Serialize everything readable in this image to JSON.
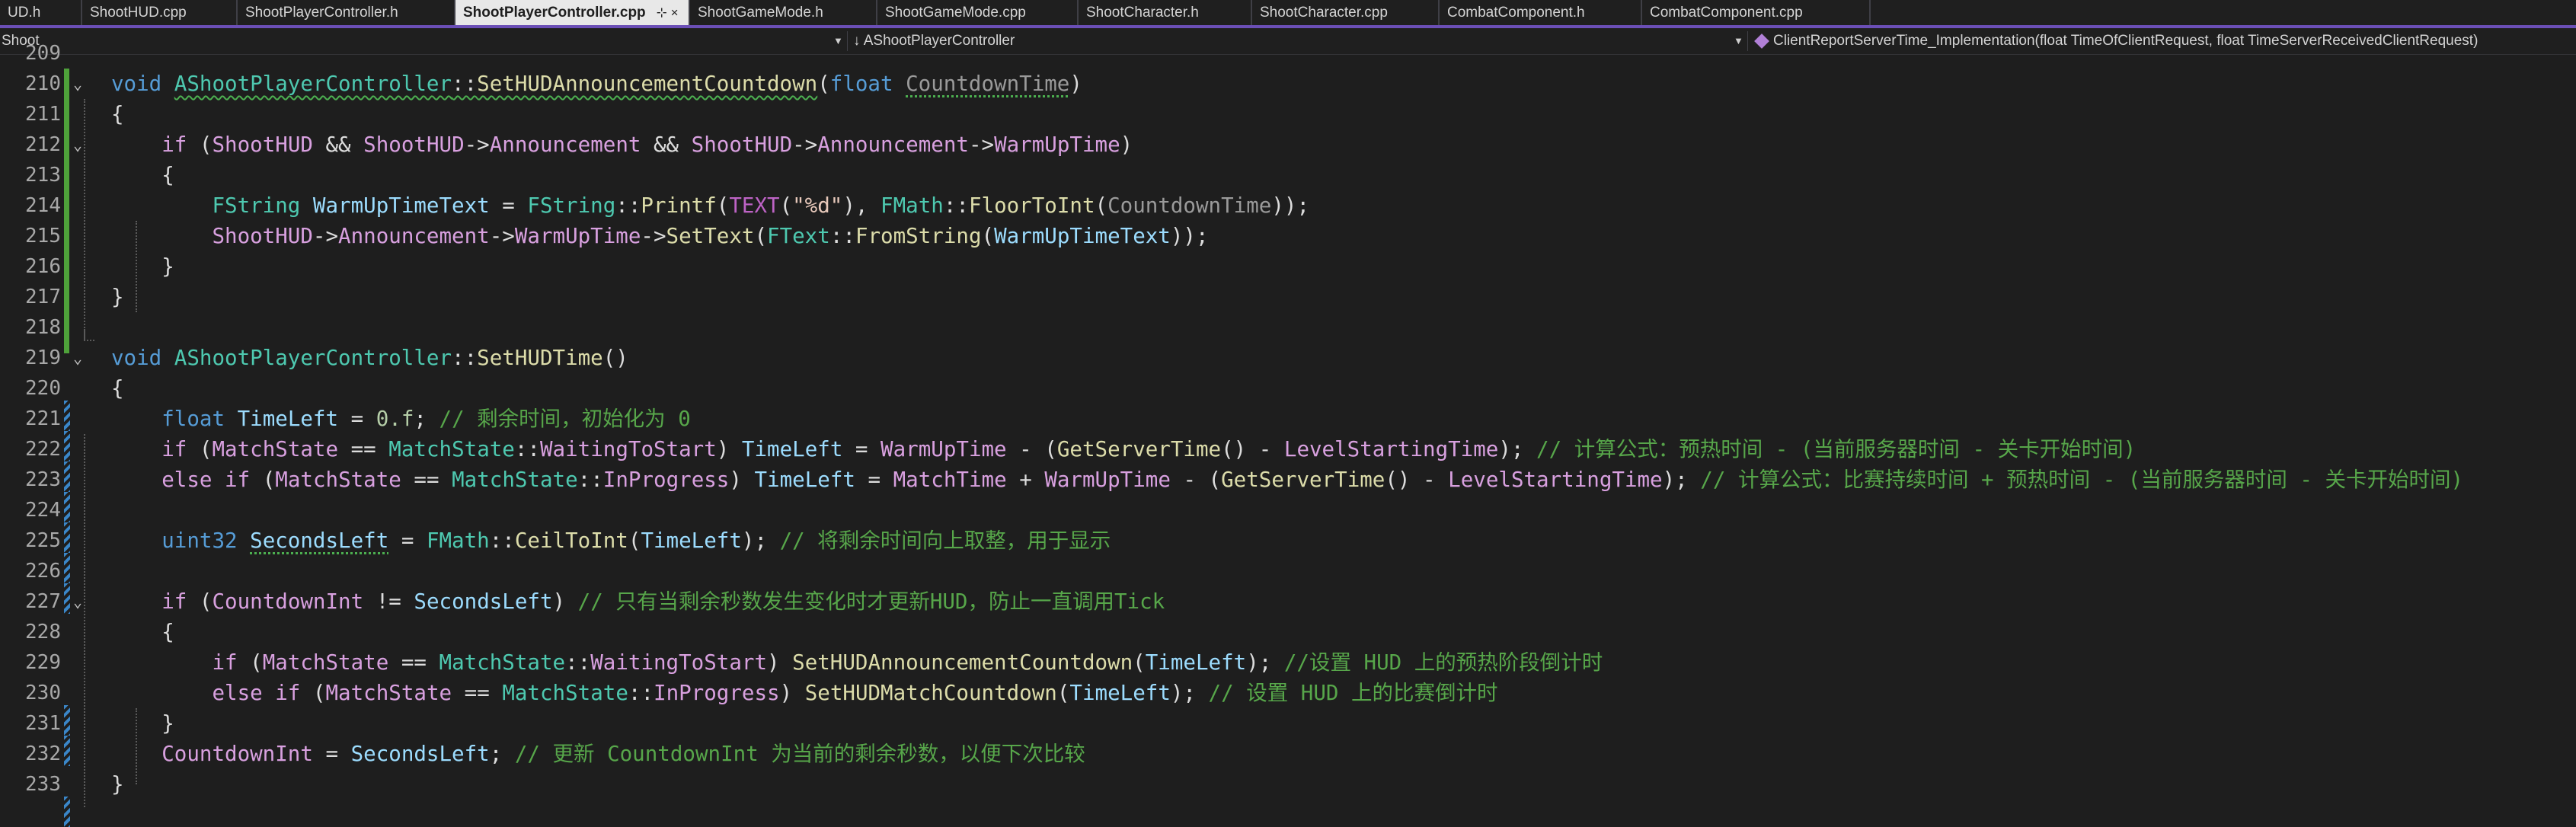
{
  "tabs": [
    {
      "label": "UD.h",
      "active": false
    },
    {
      "label": "ShootHUD.cpp",
      "active": false
    },
    {
      "label": "ShootPlayerController.h",
      "active": false
    },
    {
      "label": "ShootPlayerController.cpp",
      "active": true
    },
    {
      "label": "ShootGameMode.h",
      "active": false
    },
    {
      "label": "ShootGameMode.cpp",
      "active": false
    },
    {
      "label": "ShootCharacter.h",
      "active": false
    },
    {
      "label": "ShootCharacter.cpp",
      "active": false
    },
    {
      "label": "CombatComponent.h",
      "active": false
    },
    {
      "label": "CombatComponent.cpp",
      "active": false
    }
  ],
  "active_tab_icons": {
    "pin": "⊹",
    "close": "×"
  },
  "nav": {
    "project": "Shoot",
    "scope_arrow": "↓",
    "scope": "AShootPlayerController",
    "member": "ClientReportServerTime_Implementation(float TimeOfClientRequest, float TimeServerReceivedClientRequest)"
  },
  "editor": {
    "partial_line_number": "209",
    "line_numbers": [
      "210",
      "211",
      "212",
      "213",
      "214",
      "215",
      "216",
      "217",
      "218",
      "219",
      "220",
      "221",
      "222",
      "223",
      "224",
      "225",
      "226",
      "227",
      "228",
      "229",
      "230",
      "231",
      "232",
      "233"
    ],
    "code": {
      "l210": {
        "kw": "void",
        "cls": "AShootPlayerController",
        "sep": "::",
        "fn": "SetHUDAnnouncementCountdown",
        "open": "(",
        "ptype": "float",
        "param": "CountdownTime",
        "close": ")"
      },
      "l211": "{",
      "l212": {
        "kw": "if",
        "a": " (",
        "v1": "ShootHUD",
        "b": " && ",
        "v2": "ShootHUD",
        "c": "->",
        "m1": "Announcement",
        "d": " && ",
        "v3": "ShootHUD",
        "e": "->",
        "m2": "Announcement",
        "f": "->",
        "m3": "WarmUpTime",
        "g": ")"
      },
      "l213": "{",
      "l214": {
        "ty1": "FString",
        "var": "WarmUpTimeText",
        "eq": " = ",
        "ty2": "FString",
        "sep": "::",
        "fn1": "Printf",
        "p1": "(",
        "macro": "TEXT",
        "p2": "(",
        "str": "\"%d\"",
        "p3": "), ",
        "ty3": "FMath",
        "sep2": "::",
        "fn2": "FloorToInt",
        "p4": "(",
        "param": "CountdownTime",
        "p5": "));"
      },
      "l215": {
        "v1": "ShootHUD",
        "a": "->",
        "m1": "Announcement",
        "b": "->",
        "m2": "WarmUpTime",
        "c": "->",
        "fn1": "SetText",
        "d": "(",
        "ty": "FText",
        "sep": "::",
        "fn2": "FromString",
        "e": "(",
        "var": "WarmUpTimeText",
        "f": "));"
      },
      "l216": "}",
      "l217": "}",
      "l219": {
        "kw": "void",
        "cls": "AShootPlayerController",
        "sep": "::",
        "fn": "SetHUDTime",
        "paren": "()"
      },
      "l220": "{",
      "l221": {
        "kw": "float",
        "var": "TimeLeft",
        "eq": " = ",
        "num": "0.f",
        "semi": "; ",
        "cmt": "// 剩余时间，初始化为 0"
      },
      "l222": {
        "kw": "if",
        "a": " (",
        "m1": "MatchState",
        "b": " == ",
        "ns": "MatchState",
        "sep": "::",
        "m2": "WaitingToStart",
        "c": ") ",
        "var": "TimeLeft",
        "d": " = ",
        "m3": "WarmUpTime",
        "e": " - (",
        "fn": "GetServerTime",
        "f": "() - ",
        "m4": "LevelStartingTime",
        "g": "); ",
        "cmt": "// 计算公式：预热时间 - (当前服务器时间 - 关卡开始时间)"
      },
      "l223": {
        "kw1": "else",
        "sp": " ",
        "kw2": "if",
        "a": " (",
        "m1": "MatchState",
        "b": " == ",
        "ns": "MatchState",
        "sep": "::",
        "m2": "InProgress",
        "c": ") ",
        "var": "TimeLeft",
        "d": " = ",
        "m3": "MatchTime",
        "e": " + ",
        "m4": "WarmUpTime",
        "f": " - (",
        "fn": "GetServerTime",
        "g": "() - ",
        "m5": "LevelStartingTime",
        "h": "); ",
        "cmt": "// 计算公式：比赛持续时间 + 预热时间 - (当前服务器时间 - 关卡开始时间)"
      },
      "l225": {
        "ty": "uint32",
        "var": "SecondsLeft",
        "eq": " = ",
        "ty2": "FMath",
        "sep": "::",
        "fn": "CeilToInt",
        "a": "(",
        "v2": "TimeLeft",
        "b": "); ",
        "cmt": "// 将剩余时间向上取整，用于显示"
      },
      "l227": {
        "kw": "if",
        "a": " (",
        "m1": "CountdownInt",
        "b": " != ",
        "v1": "SecondsLeft",
        "c": ") ",
        "cmt": "// 只有当剩余秒数发生变化时才更新HUD，防止一直调用Tick"
      },
      "l228": "{",
      "l229": {
        "kw": "if",
        "a": " (",
        "m1": "MatchState",
        "b": " == ",
        "ns": "MatchState",
        "sep": "::",
        "m2": "WaitingToStart",
        "c": ") ",
        "fn": "SetHUDAnnouncementCountdown",
        "d": "(",
        "v1": "TimeLeft",
        "e": "); ",
        "cmt": "//设置 HUD 上的预热阶段倒计时"
      },
      "l230": {
        "kw1": "else",
        "sp": " ",
        "kw2": "if",
        "a": " (",
        "m1": "MatchState",
        "b": " == ",
        "ns": "MatchState",
        "sep": "::",
        "m2": "InProgress",
        "c": ") ",
        "fn": "SetHUDMatchCountdown",
        "d": "(",
        "v1": "TimeLeft",
        "e": "); ",
        "cmt": "// 设置 HUD 上的比赛倒计时"
      },
      "l231": "}",
      "l232": {
        "m1": "CountdownInt",
        "a": " = ",
        "v1": "SecondsLeft",
        "b": "; ",
        "cmt": "// 更新 CountdownInt 为当前的剩余秒数，以便下次比较"
      },
      "l233": "}"
    }
  }
}
